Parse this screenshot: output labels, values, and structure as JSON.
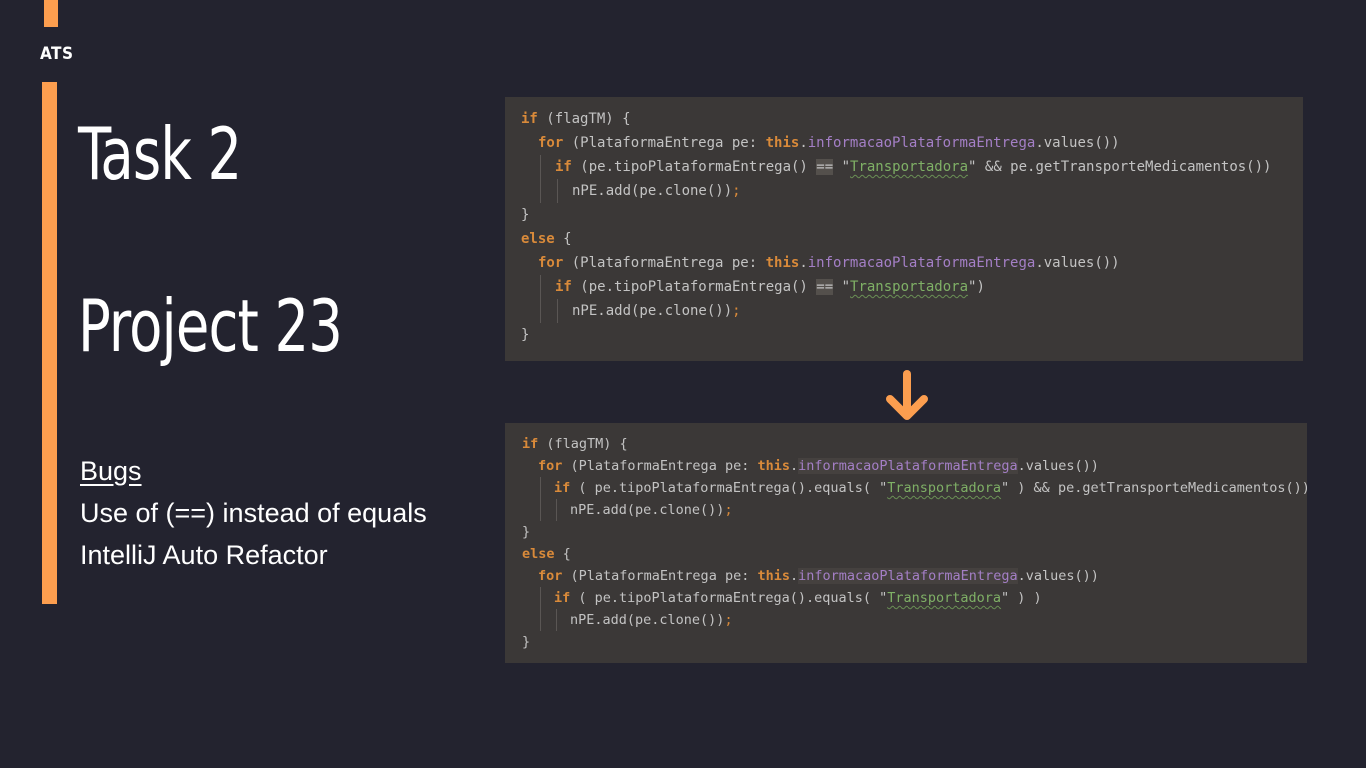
{
  "brand": "ATS",
  "titles": {
    "task": "Task 2",
    "project": "Project 23"
  },
  "notes": {
    "bugs_label": "Bugs",
    "line1": "Use of (==) instead of equals",
    "line2": "IntelliJ Auto Refactor"
  },
  "colors": {
    "accent": "#fc9e4f",
    "background": "#23232f",
    "code_bg": "#3b3837"
  },
  "arrow_icon": "arrow-down-icon",
  "before_code": [
    "if (flagTM) {",
    "for (PlataformaEntrega pe: this.informacaoPlataformaEntrega.values())",
    "if (pe.tipoPlataformaEntrega() == \"Transportadora\" && pe.getTransporteMedicamentos())",
    "nPE.add(pe.clone());",
    "}",
    "else {",
    "for (PlataformaEntrega pe: this.informacaoPlataformaEntrega.values())",
    "if (pe.tipoPlataformaEntrega() == \"Transportadora\")",
    "nPE.add(pe.clone());",
    "}"
  ],
  "after_code": [
    "if (flagTM) {",
    "for (PlataformaEntrega pe: this.informacaoPlataformaEntrega.values())",
    "if ( pe.tipoPlataformaEntrega().equals( \"Transportadora\" ) && pe.getTransporteMedicamentos())",
    "nPE.add(pe.clone());",
    "}",
    "else {",
    "for (PlataformaEntrega pe: this.informacaoPlataformaEntrega.values())",
    "if ( pe.tipoPlataformaEntrega().equals( \"Transportadora\" ) )",
    "nPE.add(pe.clone());",
    "}"
  ]
}
